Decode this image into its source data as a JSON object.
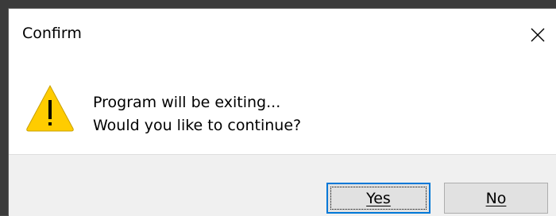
{
  "dialog": {
    "title": "Confirm",
    "message_line1": "Program will be exiting...",
    "message_line2": "Would you like to continue?",
    "icon": "warning-icon",
    "buttons": {
      "yes_label": "Yes",
      "no_label": "No"
    },
    "colors": {
      "warning_fill": "#FFCC00",
      "focus_border": "#0078D7",
      "footer_bg": "#F0F0F0",
      "button_bg": "#E1E1E1"
    }
  }
}
